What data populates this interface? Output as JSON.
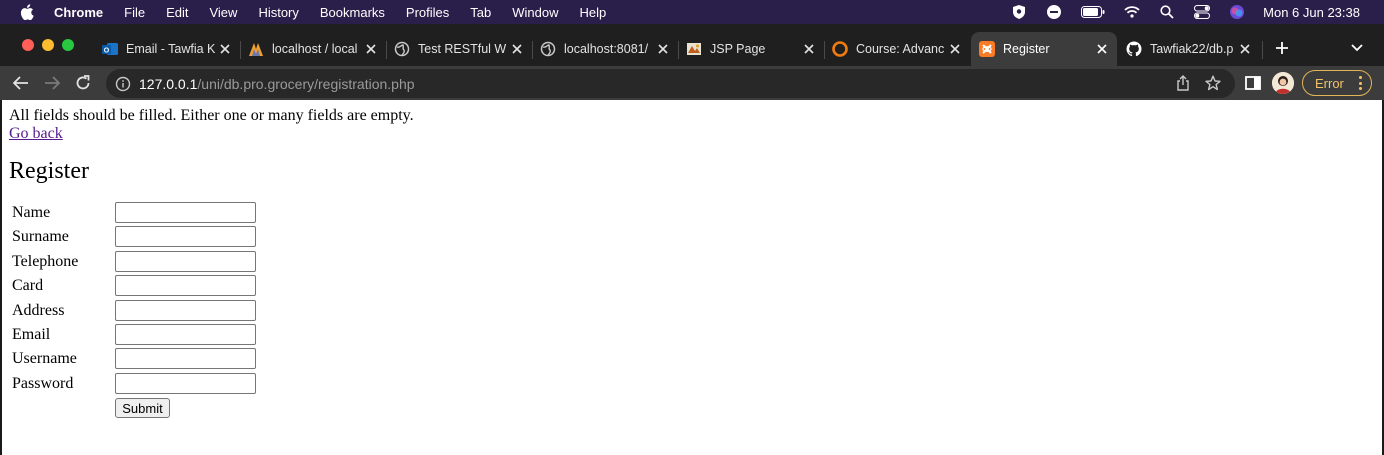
{
  "menubar": {
    "app_name": "Chrome",
    "items": [
      "File",
      "Edit",
      "View",
      "History",
      "Bookmarks",
      "Profiles",
      "Tab",
      "Window",
      "Help"
    ],
    "clock": "Mon 6 Jun  23:38",
    "status_icons": [
      "vpn-shield-icon",
      "focus-icon",
      "battery-icon",
      "wifi-icon",
      "spotlight-search-icon",
      "control-center-icon",
      "siri-icon"
    ]
  },
  "tabs": [
    {
      "title": "Email - Tawfia K",
      "icon": "outlook-icon"
    },
    {
      "title": "localhost / local",
      "icon": "phpmyadmin-icon"
    },
    {
      "title": "Test RESTful W",
      "icon": "globe-icon"
    },
    {
      "title": "localhost:8081/",
      "icon": "globe-icon"
    },
    {
      "title": "JSP Page",
      "icon": "jsp-icon"
    },
    {
      "title": "Course: Advanc",
      "icon": "moodle-icon"
    },
    {
      "title": "Register",
      "icon": "xampp-icon",
      "active": true
    },
    {
      "title": "Tawfiak22/db.p",
      "icon": "github-icon"
    }
  ],
  "toolbar": {
    "url_host": "127.0.0.1",
    "url_path": "/uni/db.pro.grocery/registration.php",
    "error_label": "Error"
  },
  "page": {
    "message": "All fields should be filled. Either one or many fields are empty.",
    "go_back": "Go back",
    "heading": "Register",
    "fields": [
      {
        "label": "Name",
        "value": ""
      },
      {
        "label": "Surname",
        "value": ""
      },
      {
        "label": "Telephone",
        "value": ""
      },
      {
        "label": "Card",
        "value": ""
      },
      {
        "label": "Address",
        "value": ""
      },
      {
        "label": "Email",
        "value": ""
      },
      {
        "label": "Username",
        "value": ""
      },
      {
        "label": "Password",
        "value": ""
      }
    ],
    "submit_label": "Submit"
  },
  "colors": {
    "menubar_bg": "#2a1e4a",
    "tabstrip_bg": "#1f1f1f",
    "toolbar_bg": "#3c3c3c",
    "omnibox_bg": "#282828",
    "error_accent": "#f2c36b",
    "visited_link": "#551a8b"
  }
}
